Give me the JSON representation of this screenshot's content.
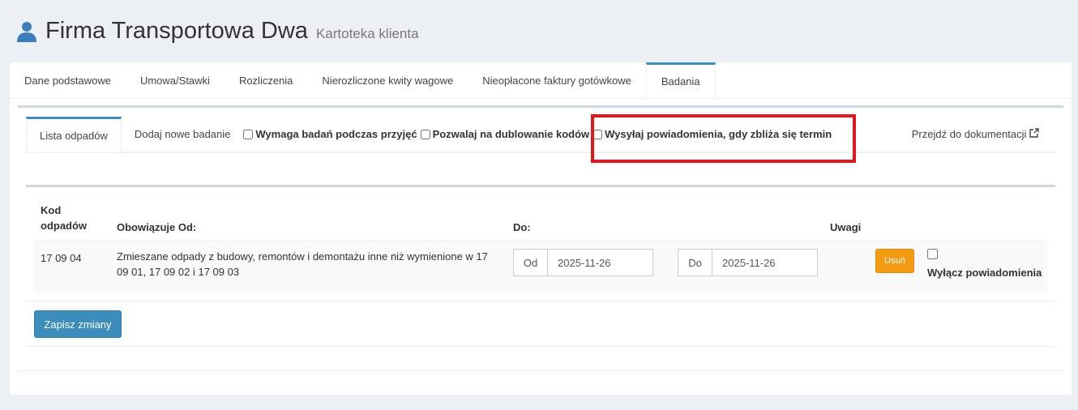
{
  "header": {
    "title": "Firma Transportowa Dwa",
    "subtitle": "Kartoteka klienta",
    "icon": "user-icon"
  },
  "tabs": [
    {
      "label": "Dane podstawowe"
    },
    {
      "label": "Umowa/Stawki"
    },
    {
      "label": "Rozliczenia"
    },
    {
      "label": "Nierozliczone kwity wagowe"
    },
    {
      "label": "Nieopłacone faktury gotówkowe"
    },
    {
      "label": "Badania",
      "active": true
    }
  ],
  "subtabs": {
    "list": "Lista odpadów",
    "add": "Dodaj nowe badanie",
    "doc": "Przejdź do dokumentacji",
    "doc_icon": "external-link-icon"
  },
  "options": [
    {
      "label": "Wymaga badań podczas przyjęć",
      "checked": false
    },
    {
      "label": "Pozwalaj na dublowanie kodów",
      "checked": false
    },
    {
      "label": "Wysyłaj powiadomienia, gdy zbliża się termin",
      "checked": false,
      "highlighted": true
    }
  ],
  "highlight_color": "#e3161d",
  "table": {
    "headers": {
      "code_1": "Kod",
      "code_2": "odpadów",
      "from": "Obowiązuje Od:",
      "to": "Do:",
      "notes": "Uwagi"
    },
    "rows": [
      {
        "code": "17 09 04",
        "desc": "Zmieszane odpady z budowy, remontów i demontażu inne niż wymienione w 17 09 01, 17 09 02 i 17 09 03",
        "from_addon": "Od",
        "from": "2025-11-26",
        "to_addon": "Do",
        "to": "2025-11-26",
        "delete": "Usuń",
        "disable_label": "Wyłącz powiadomienia",
        "disable_checked": false
      }
    ]
  },
  "save_label": "Zapisz zmiany"
}
